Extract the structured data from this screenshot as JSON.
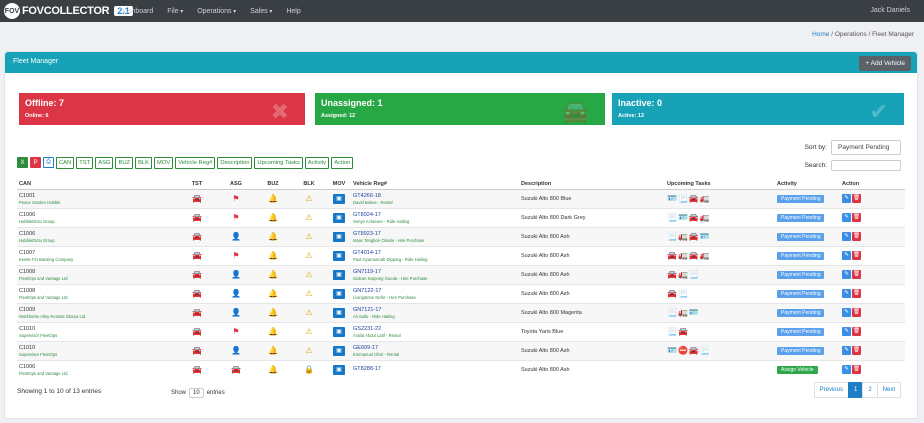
{
  "nav": {
    "logo_fov": "FOV",
    "brand": "FOVCOLLECTOR",
    "version": "2.1",
    "links": [
      "Dashboard",
      "File",
      "Operations",
      "Sales",
      "Help"
    ],
    "user": "Jack Daniels"
  },
  "breadcrumb": {
    "home": "Home",
    "sep1": "/",
    "section": "Operations",
    "sep2": "/",
    "page": "Fleet Manager"
  },
  "card": {
    "title": "Fleet Manager",
    "add_label": "+ Add Vehicle"
  },
  "stats": {
    "offline": {
      "title": "Offline: 7",
      "sub": "Online: 6",
      "color": "#dc3545"
    },
    "unassigned": {
      "title": "Unassigned: 1",
      "sub": "Assigned: 12",
      "color": "#28a745"
    },
    "inactive": {
      "title": "Inactive: 0",
      "sub": "Active: 13",
      "color": "#17a2b8"
    }
  },
  "sort": {
    "label": "Sort by:",
    "value": "Payment Pending"
  },
  "search": {
    "label": "Search:"
  },
  "toggles": [
    "CAN",
    "TST",
    "ASG",
    "BUZ",
    "BLK",
    "MOV",
    "Vehicle Reg#",
    "Description",
    "Upcoming Tasks",
    "Activity",
    "Action"
  ],
  "columns": [
    "CAN",
    "TST",
    "ASG",
    "BUZ",
    "BLK",
    "MOV",
    "Vehicle Reg#",
    "Description",
    "Upcoming Tasks",
    "Activity",
    "Action"
  ],
  "rows": [
    {
      "can": "C1001",
      "org": "Peace Garden Hubble",
      "tst": "🚘",
      "tstc": "green",
      "asg": "flag",
      "buz": "🔔",
      "blk": "warn",
      "reg": "GT4266-18",
      "regs": "David Bekoe - Rental",
      "desc": "Suzuki Alto 800 Blue",
      "tasks": "🪪📃🚘🚛",
      "activity": "Payment Pending"
    },
    {
      "can": "C1006",
      "org": "HubbleDictu Group",
      "tst": "🚘",
      "tstc": "green",
      "asg": "flag",
      "buz": "🔔",
      "blk": "warn",
      "reg": "GT8924-17",
      "regs": "Senyo Acheivier - Ride Hailing",
      "desc": "Suzuki Alto 800 Dark Grey",
      "tasks": "📃🪪🚘🚛",
      "activity": "Payment Pending"
    },
    {
      "can": "C1006",
      "org": "HubbleDictu Group",
      "tst": "🚘",
      "tstc": "red",
      "asg": "person",
      "buz": "🔔",
      "blk": "warn",
      "reg": "GT8923-17",
      "regs": "Isaac Tengbon Obode - Hire Purchase",
      "desc": "Suzuki Alto 800 Ash",
      "tasks": "📃🚛🚘🪪",
      "activity": "Payment Pending"
    },
    {
      "can": "C1007",
      "org": "Keeke Fin Banking Company",
      "tst": "🚘",
      "tstc": "green",
      "asg": "flag",
      "buz": "🔔",
      "blk": "warn",
      "reg": "GT4014-17",
      "regs": "Paul Gyamunnah Dipparg - Ride Hailing",
      "desc": "Suzuki Alto 800 Ash",
      "tasks": "🚘🚛🚘🚛",
      "activity": "Payment Pending"
    },
    {
      "can": "C1008",
      "org": "FleetOps and Vantage Ltd",
      "tst": "🚘",
      "tstc": "red",
      "asg": "person",
      "buz": "🔔",
      "blk": "warn",
      "reg": "GN7119-17",
      "regs": "Gideon Sarpong Gueda - Hire Purchase",
      "desc": "Suzuki Alto 800 Ash",
      "tasks": "🚘🚛📃",
      "activity": "Payment Pending"
    },
    {
      "can": "C1008",
      "org": "FleetOps and Vantage Ltd",
      "tst": "🚘",
      "tstc": "red",
      "asg": "person",
      "buz": "🔔",
      "blk": "warn",
      "reg": "GN7122-17",
      "regs": "Livingstone Defor - Hire Purchase",
      "desc": "Suzuki Alto 800 Ash",
      "tasks": "🚘📃",
      "activity": "Payment Pending"
    },
    {
      "can": "C1009",
      "org": "Workhorse Alloy Rentals Ghana Ltd",
      "tst": "🚘",
      "tstc": "red",
      "asg": "person",
      "buz": "🔔",
      "blk": "warn",
      "reg": "GN7121-17",
      "regs": "Ali Saifu - Ride Hailing",
      "desc": "Suzuki Alto 800 Magenta",
      "tasks": "📃🚛🪪",
      "activity": "Payment Pending"
    },
    {
      "can": "C1010",
      "org": "Supervisor FleetOps",
      "tst": "🚘",
      "tstc": "green",
      "asg": "flag",
      "buz": "🔔",
      "blk": "warn",
      "reg": "GS2231-22",
      "regs": "Arafat Abdul Latif - Rental",
      "desc": "Toyota Yaris Blue",
      "tasks": "📃🚘",
      "activity": "Payment Pending"
    },
    {
      "can": "C1010",
      "org": "Supervisor FleetOps",
      "tst": "🚘",
      "tstc": "red",
      "asg": "person",
      "buz": "🔔",
      "blk": "warn",
      "reg": "GE609-17",
      "regs": "Emmanuel Ofori - Rental",
      "desc": "Suzuki Alto 800 Ash",
      "tasks": "🪪⛔🚘📃",
      "activity": "Payment Pending"
    },
    {
      "can": "C1006",
      "org": "FleetOps and Vantage Ltd",
      "tst": "🚘",
      "tstc": "red",
      "asg": "car",
      "buz": "🔔",
      "blk": "lock",
      "reg": "GT8288-17",
      "regs": "",
      "desc": "Suzuki Alto 800 Ash",
      "tasks": "",
      "activity": "Assign Vehicle"
    }
  ],
  "footer": {
    "info": "Showing 1 to 10 of 13 entries",
    "show": "Show",
    "entries_value": "10",
    "entries": "entries"
  },
  "pager": {
    "prev": "Previous",
    "p1": "1",
    "p2": "2",
    "next": "Next"
  }
}
